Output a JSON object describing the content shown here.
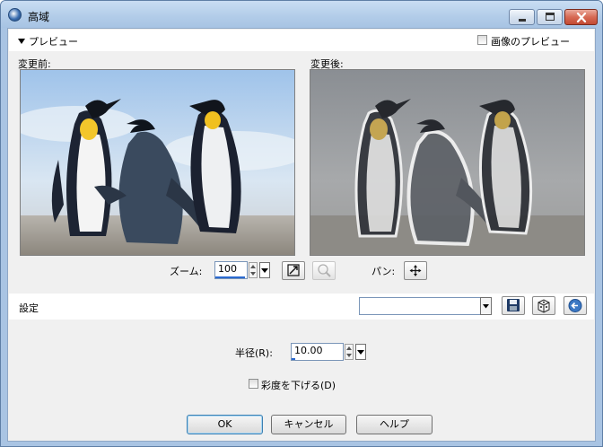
{
  "window": {
    "title": "高域",
    "icon": "app-icon"
  },
  "titlebar_buttons": [
    "minimize-icon",
    "maximize-icon",
    "close-icon"
  ],
  "preview": {
    "header": "プレビュー",
    "image_preview_label": "画像のプレビュー",
    "image_preview_checked": false,
    "before_label": "変更前:",
    "after_label": "変更後:"
  },
  "zoom": {
    "label": "ズーム:",
    "value": "100",
    "fit_icon": "fit-window-icon",
    "zoom_icon": "zoom-actual-icon",
    "pan_label": "パン:",
    "pan_icon": "pan-move-icon"
  },
  "settings": {
    "label": "設定",
    "preset_value": "",
    "save_icon": "save-floppy-icon",
    "random_icon": "dice-icon",
    "reset_icon": "reset-arrow-icon"
  },
  "params": {
    "radius_label": "半径(R):",
    "radius_value": "10.00",
    "desaturate_label": "彩度を下げる(D)",
    "desaturate_checked": false
  },
  "buttons": {
    "ok": "OK",
    "cancel": "キャンセル",
    "help": "ヘルプ"
  }
}
